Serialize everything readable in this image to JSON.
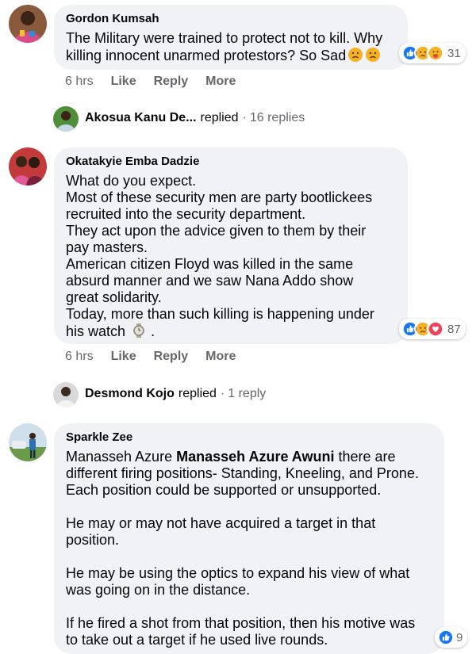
{
  "comments": [
    {
      "author": "Gordon Kumsah",
      "lines": [
        "The Military were trained to protect not to kill. Why",
        "killing innocent unarmed protestors? So Sad"
      ],
      "time": "6 hrs",
      "like": "Like",
      "reply": "Reply",
      "more": "More",
      "reaction_count": "31",
      "reaction_icons": [
        "like-icon",
        "sad-icon",
        "care-icon"
      ]
    },
    {
      "author": "Okatakyie Emba Dadzie",
      "lines": [
        "What do you expect.",
        "Most of these security men are party bootlickees",
        "recruited into the security department.",
        "They act upon the advice given to them by their",
        "pay masters.",
        "American citizen Floyd was killed in the same",
        "absurd manner and we saw Nana Addo show",
        "great solidarity.",
        "Today, more than such killing is happening under",
        "his watch"
      ],
      "time": "6 hrs",
      "like": "Like",
      "reply": "Reply",
      "more": "More",
      "reaction_count": "87",
      "reaction_icons": [
        "like-icon",
        "sad-icon",
        "love-icon"
      ]
    },
    {
      "author": "Sparkle Zee",
      "mention_plain": "Manasseh Azure",
      "mention_bold": "Manasseh Azure Awuni",
      "lines": [
        "there are",
        "different firing positions- Standing, Kneeling, and Prone.",
        "Each position could be supported or unsupported.",
        "He may or may not have acquired a target in that",
        "position.",
        "He may be using the optics to expand his view of what",
        "was going on in the distance.",
        "If he fired a shot from that position, then his motive was",
        "to take out a target if he used live rounds."
      ],
      "reaction_count": "9",
      "reaction_icons": [
        "like-icon"
      ]
    }
  ],
  "replies": [
    {
      "name": "Akosua Kanu De...",
      "verb": "replied",
      "separator": "·",
      "count": "16 replies"
    },
    {
      "name": "Desmond Kojo",
      "verb": "replied",
      "separator": "·",
      "count": "1 reply"
    }
  ],
  "colors": {
    "bubble": "#f0f2f5",
    "like_blue": "#1877f2",
    "love_red": "#f33e58",
    "sad_yellow": "#f7b125",
    "secondary_text": "#65676b"
  }
}
